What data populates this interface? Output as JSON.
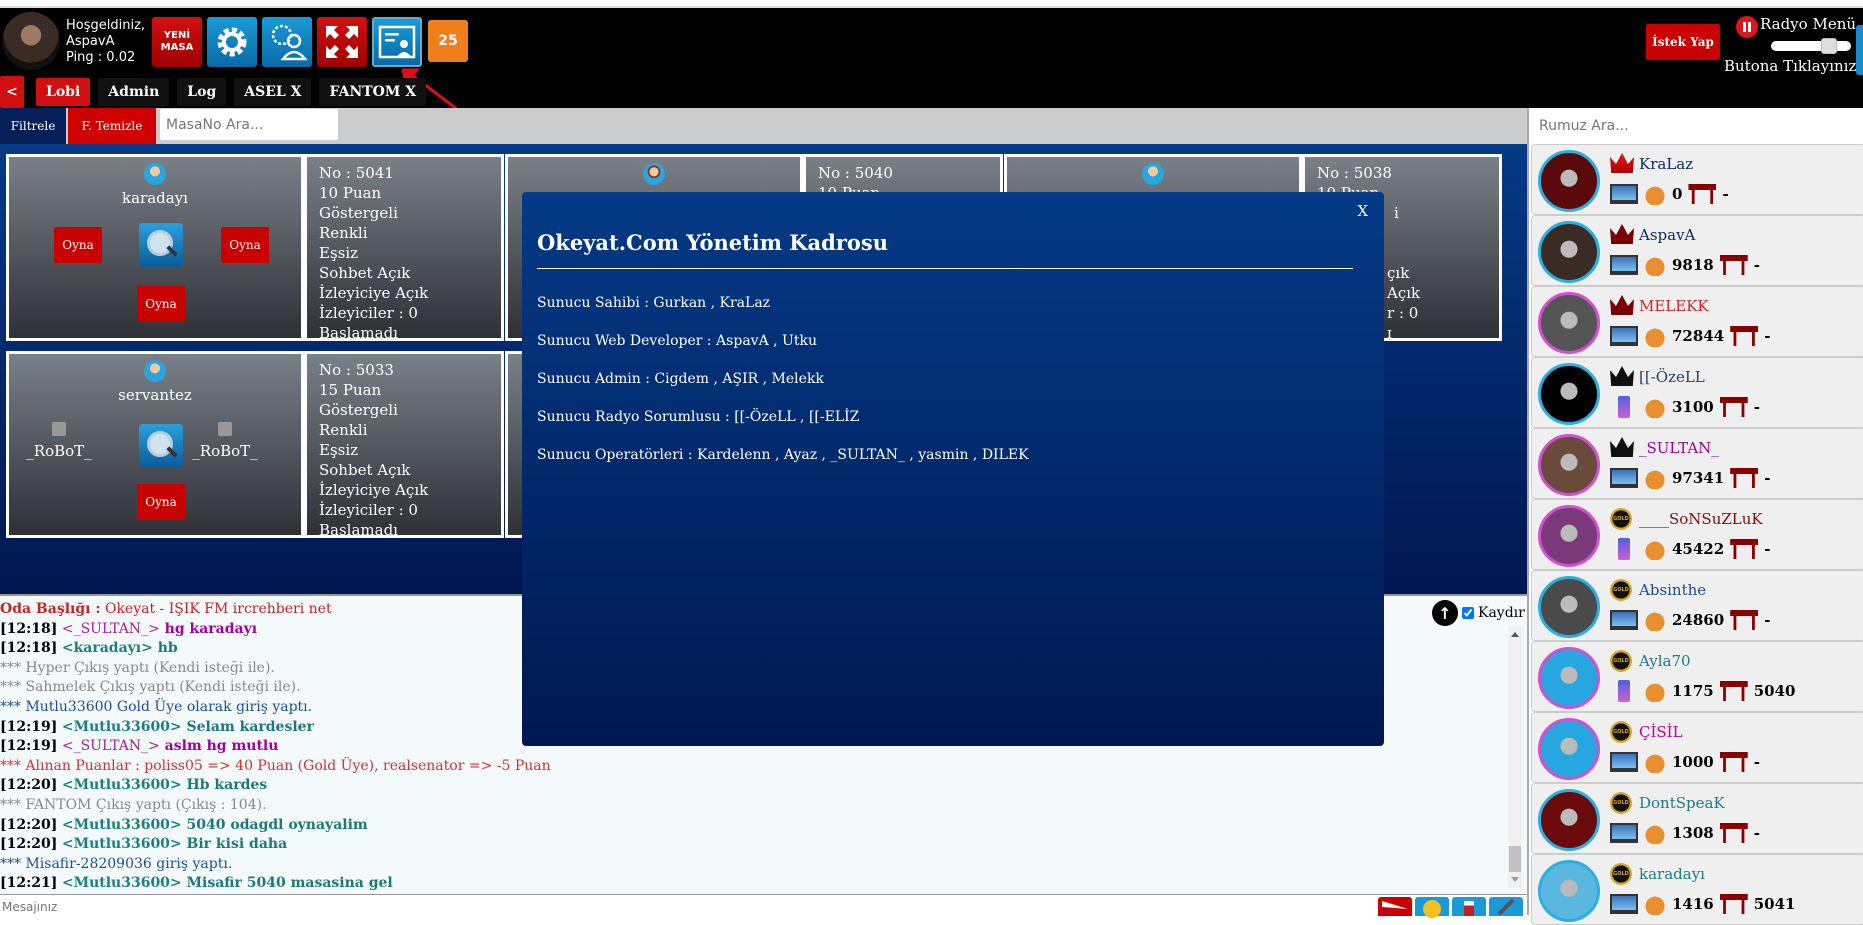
{
  "header": {
    "welcome_line1": "Hoşgeldiniz,",
    "username": "AspavA",
    "ping": "Ping : 0.02",
    "new_table_label_1": "YENİ",
    "new_table_label_2": "MASA",
    "count_badge": "25",
    "request_button": "İstek Yap",
    "radio_title": "Radyo Menü",
    "radio_sub": "Butona Tıklayınız",
    "radio_volume": 0.75
  },
  "tabs": [
    {
      "label": "<",
      "active": false
    },
    {
      "label": "Lobi",
      "active": true
    },
    {
      "label": "Admin",
      "active": false
    },
    {
      "label": "Log",
      "active": false
    },
    {
      "label": "ASEL X",
      "active": false
    },
    {
      "label": "FANTOM X",
      "active": false
    }
  ],
  "filter": {
    "filter_button": "Filtrele",
    "clear_button": "F. Temizle",
    "search_placeholder": "MasaNo Ara..."
  },
  "tables": [
    {
      "owner": "karadayı",
      "seats": [
        "Oyna",
        "Oyna",
        "Oyna"
      ],
      "info": [
        "No : 5041",
        "10 Puan",
        "Göstergeli",
        "Renkli",
        "Eşsiz",
        "Sohbet Açık",
        "İzleyiciye Açık",
        "İzleyiciler : 0",
        "Başlamadı"
      ]
    },
    {
      "owner": "",
      "info": [
        "No : 5040",
        "10 Puan"
      ]
    },
    {
      "owner": "",
      "info": [
        "No : 5038",
        "10 Puan",
        "i",
        "",
        "",
        "çık",
        "Açık",
        "r : 0",
        "ɪ"
      ]
    },
    {
      "owner": "servantez",
      "robots": [
        "_RoBoT_",
        "_RoBoT_"
      ],
      "seats": [
        "Oyna"
      ],
      "info": [
        "No : 5033",
        "15 Puan",
        "Göstergeli",
        "Renkli",
        "Eşsiz",
        "Sohbet Açık",
        "İzleyiciye Açık",
        "İzleyiciler : 0",
        "Başlamadı"
      ]
    }
  ],
  "modal": {
    "title": "Okeyat.Com Yönetim Kadrosu",
    "close": "X",
    "lines": [
      "Sunucu Sahibi : Gurkan , KraLaz",
      "Sunucu Web Developer : AspavA , Utku",
      "Sunucu Admin : Cigdem , AŞIR , Melekk",
      "Sunucu Radyo Sorumlusu : [[-ÖzeLL , [[-ELİZ",
      "Sunucu Operatörleri : Kardelenn , Ayaz , _SULTAN_ , yasmin , DILEK"
    ]
  },
  "chat": {
    "room_title_label": "Oda Başlığı :",
    "room_title": " Okeyat - IŞIK FM ircrehberi net",
    "scroll_label": "Kaydır",
    "scroll_checked": true,
    "message_placeholder": "Mesajınız",
    "lines": [
      {
        "type": "msg",
        "time": "[12:18]",
        "nick": "<_SULTAN_>",
        "text": " hg karadayı",
        "nick_class": "nk-purple",
        "text_class": "msg-purple"
      },
      {
        "type": "msg",
        "time": "[12:18]",
        "nick": "<karadayı>",
        "text": " hb",
        "nick_class": "nk-teal",
        "text_class": "msg-teal"
      },
      {
        "type": "sys",
        "text": "*** Hyper Çıkış yaptı (Kendi isteği ile).",
        "cls": "l-sys"
      },
      {
        "type": "sys",
        "text": "*** Sahmelek Çıkış yaptı (Kendi isteği ile).",
        "cls": "l-sys"
      },
      {
        "type": "sys",
        "text": "*** Mutlu33600 Gold Üye olarak giriş yaptı.",
        "cls": "l-blue"
      },
      {
        "type": "msg",
        "time": "[12:19]",
        "nick": "<Mutlu33600>",
        "text": " Selam kardesler",
        "nick_class": "nk-teal",
        "text_class": "msg-teal"
      },
      {
        "type": "msg",
        "time": "[12:19]",
        "nick": "<_SULTAN_>",
        "text": " aslm hg mutlu",
        "nick_class": "nk-purple",
        "text_class": "msg-purple"
      },
      {
        "type": "sys",
        "text": "*** Alınan Puanlar : poliss05 => 40 Puan (Gold Üye), realsenator => -5 Puan",
        "cls": "l-red"
      },
      {
        "type": "msg",
        "time": "[12:20]",
        "nick": "<Mutlu33600>",
        "text": " Hb kardes",
        "nick_class": "nk-teal",
        "text_class": "msg-teal"
      },
      {
        "type": "sys",
        "text": "*** FANTOM Çıkış yaptı (Çıkış : 104).",
        "cls": "l-sys"
      },
      {
        "type": "msg",
        "time": "[12:20]",
        "nick": "<Mutlu33600>",
        "text": " 5040 odagdl oynayalim",
        "nick_class": "nk-teal",
        "text_class": "msg-teal"
      },
      {
        "type": "msg",
        "time": "[12:20]",
        "nick": "<Mutlu33600>",
        "text": " Bir kisi daha",
        "nick_class": "nk-teal",
        "text_class": "msg-teal"
      },
      {
        "type": "sys",
        "text": "*** Misafir-28209036 giriş yaptı.",
        "cls": "l-blue"
      },
      {
        "type": "msg",
        "time": "[12:21]",
        "nick": "<Mutlu33600>",
        "text": " Misafir 5040 masasina gel",
        "nick_class": "nk-teal",
        "text_class": "msg-teal"
      }
    ]
  },
  "sidebar": {
    "search_placeholder": "Rumuz Ara...",
    "users": [
      {
        "name": "KraLaz",
        "badge": "crown-red",
        "device": "pc",
        "points": "0",
        "table": "-",
        "name_color": "#0a2a6a",
        "ring": "blue",
        "avatar_color": "#5a0a0a"
      },
      {
        "name": "AspavA",
        "badge": "crown-dark",
        "device": "pc",
        "points": "9818",
        "table": "-",
        "name_color": "#0a2a6a",
        "ring": "blue",
        "avatar_color": "#3a2c25"
      },
      {
        "name": "MELEKK",
        "badge": "crown-dark",
        "device": "pc",
        "points": "72844",
        "table": "-",
        "name_color": "#e02020",
        "ring": "pink",
        "avatar_color": "#555"
      },
      {
        "name": "[[-ÖzeLL",
        "badge": "crown-black",
        "device": "phone",
        "points": "3100",
        "table": "-",
        "name_color": "#2a3a6a",
        "ring": "blue",
        "avatar_color": "#000"
      },
      {
        "name": "_SULTAN_",
        "badge": "crown-black",
        "device": "pc",
        "points": "97341",
        "table": "-",
        "name_color": "#a000a0",
        "ring": "pink",
        "avatar_color": "#6a4a3a"
      },
      {
        "name": "____SoNSuZLuK",
        "badge": "gold",
        "device": "phone",
        "points": "45422",
        "table": "-",
        "name_color": "#8a0a0a",
        "ring": "pink",
        "avatar_color": "#7a3a7a"
      },
      {
        "name": "Absinthe",
        "badge": "gold",
        "device": "pc",
        "points": "24860",
        "table": "-",
        "name_color": "#1a4a9a",
        "ring": "blue",
        "avatar_color": "#4a4a4a"
      },
      {
        "name": "Ayla70",
        "badge": "gold",
        "device": "phone",
        "points": "1175",
        "table": "5040",
        "name_color": "#1a7a8a",
        "ring": "pink",
        "avatar_color": "#28a6e0"
      },
      {
        "name": "ÇİSİL",
        "badge": "gold",
        "device": "pc",
        "points": "1000",
        "table": "-",
        "name_color": "#c000a0",
        "ring": "pink",
        "avatar_color": "#28a6e0"
      },
      {
        "name": "DontSpeaK",
        "badge": "gold",
        "device": "pc",
        "points": "1308",
        "table": "-",
        "name_color": "#1a7a8a",
        "ring": "blue",
        "avatar_color": "#6a0a0a"
      },
      {
        "name": "karadayı",
        "badge": "gold",
        "device": "pc",
        "points": "1416",
        "table": "5041",
        "name_color": "#1a7a8a",
        "ring": "blue",
        "avatar_color": "#5ab8e0"
      }
    ]
  },
  "colors": {
    "brand_red": "#d01010",
    "brand_blue": "#1a9ad8",
    "navy": "#043a86",
    "orange": "#ef7f1a"
  }
}
